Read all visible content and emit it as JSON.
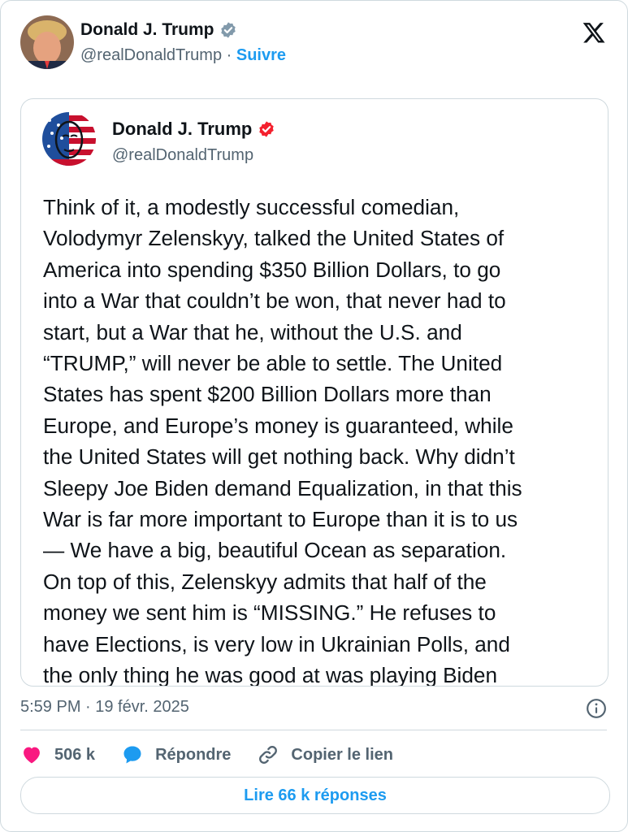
{
  "header": {
    "name": "Donald J. Trump",
    "handle": "@realDonaldTrump",
    "separator": " · ",
    "follow_label": "Suivre",
    "logo": "x-logo-icon"
  },
  "quoted": {
    "name": "Donald J. Trump",
    "handle": "@realDonaldTrump",
    "text": "Think of it, a modestly successful comedian,\nVolodymyr Zelenskyy, talked the United States of\nAmerica into spending $350 Billion Dollars, to go\ninto a War that couldn’t be won, that never had to\nstart, but a War that he, without the U.S. and\n“TRUMP,” will never be able to settle. The United\nStates has spent $200 Billion Dollars more than\nEurope, and Europe’s money is guaranteed, while\nthe United States will get nothing back. Why didn’t\nSleepy Joe Biden demand Equalization, in that this\nWar is far more important to Europe than it is to us\n— We have a big, beautiful Ocean as separation.\nOn top of this, Zelenskyy admits that half of the\nmoney we sent him is “MISSING.” He refuses to\nhave Elections, is very low in Ukrainian Polls, and\nthe only thing he was good at was playing Biden"
  },
  "meta": {
    "timestamp": "5:59 PM · 19 févr. 2025"
  },
  "actions": {
    "like_count": "506 k",
    "reply_label": "Répondre",
    "copy_label": "Copier le lien"
  },
  "reply_button": {
    "label": "Lire 66 k réponses"
  },
  "colors": {
    "accent": "#1d9bf0",
    "verified_blue": "#1d9bf0",
    "verified_red": "#f4212e",
    "like": "#f91880",
    "muted": "#536471",
    "border": "#cfd9de"
  }
}
